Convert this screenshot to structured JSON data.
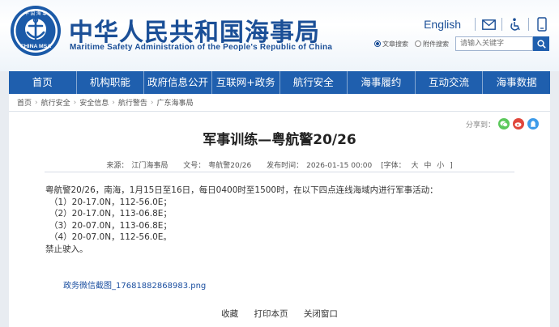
{
  "header": {
    "logo_text": "CHINA MSA",
    "logo_top_text": "中 国 海 事",
    "title": "中华人民共和国海事局",
    "subtitle": "Maritime Safety Administration of the People's Republic of China",
    "lang_link": "English"
  },
  "search": {
    "option1": "文章搜索",
    "option2": "附件搜索",
    "placeholder": "请输入关键字"
  },
  "nav": {
    "items": [
      "首页",
      "机构职能",
      "政府信息公开",
      "互联网+政务",
      "航行安全",
      "海事履约",
      "互动交流",
      "海事数据"
    ]
  },
  "breadcrumb": {
    "items": [
      "首页",
      "航行安全",
      "安全信息",
      "航行警告",
      "广东海事局"
    ],
    "separator": "›"
  },
  "share": {
    "label": "分享到："
  },
  "article": {
    "title": "军事训练—粤航警20/26",
    "meta": {
      "source_label": "来源：",
      "source": "江门海事局",
      "doc_label": "文号：",
      "doc_no": "粤航警20/26",
      "time_label": "发布时间：",
      "time": "2026-01-15 00:00",
      "font_label": "[字体：",
      "font_large": "大",
      "font_mid": "中",
      "font_small": "小",
      "font_end": "]"
    },
    "lines": [
      "粤航警20/26，南海，1月15日至16日，每日0400时至1500时，在以下四点连线海域内进行军事活动：",
      "（1）20-17.0N，112-56.0E；",
      "（2）20-17.0N，113-06.8E；",
      "（3）20-07.0N，113-06.8E；",
      "（4）20-07.0N，112-56.0E。",
      "禁止驶入。"
    ],
    "attachment": "政务微信截图_17681882868983.png"
  },
  "bottom": {
    "favorite": "收藏",
    "print": "打印本页",
    "close": "关闭窗口"
  },
  "colors": {
    "brand_blue": "#1f5fae",
    "title_blue": "#1b4f97",
    "wechat_green": "#5bc85b",
    "weibo_red": "#e0463b",
    "qq_blue": "#3d9be9"
  }
}
